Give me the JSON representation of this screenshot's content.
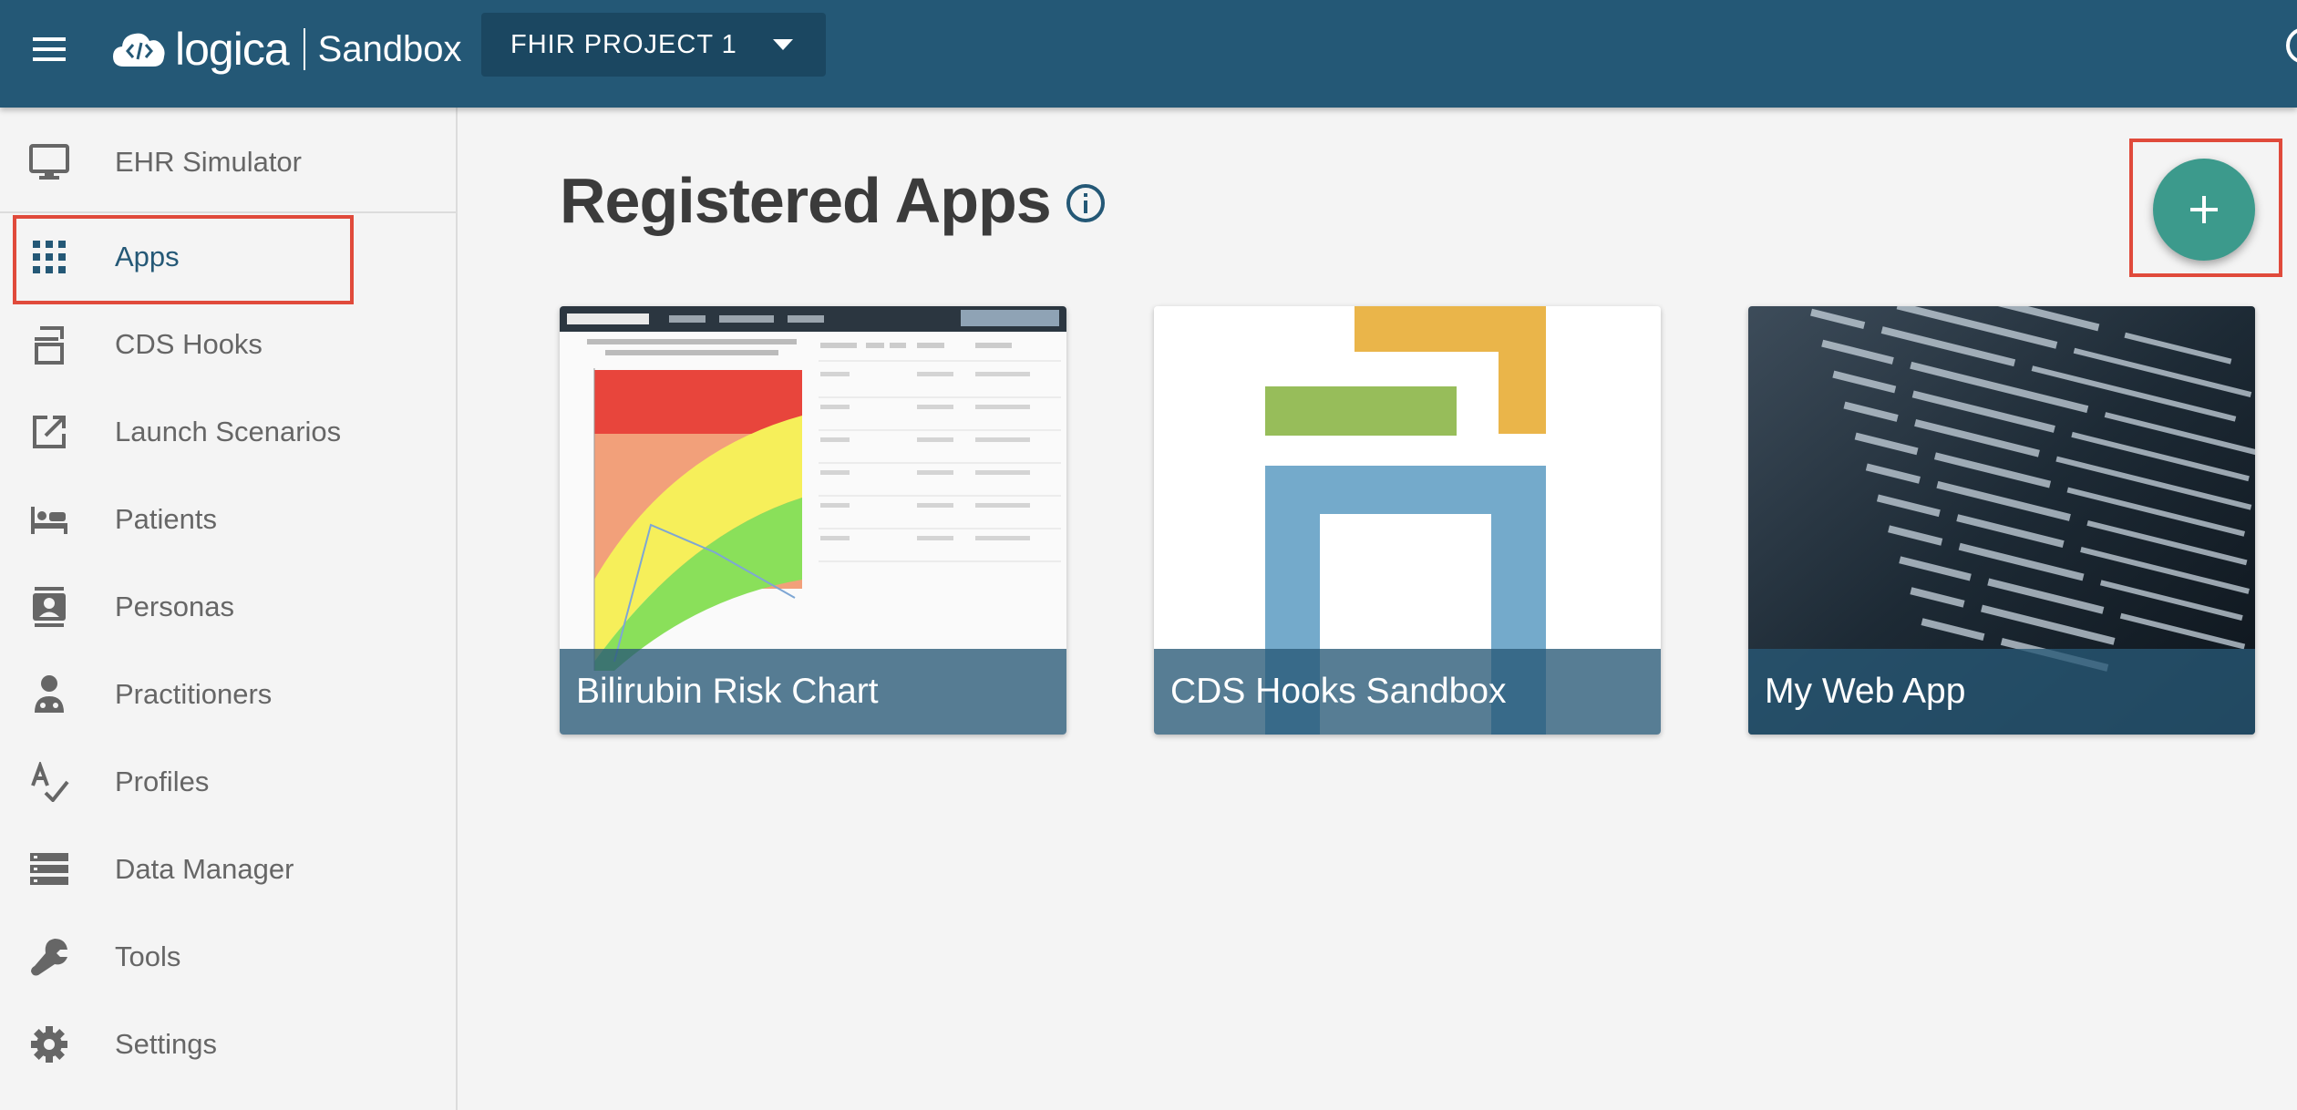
{
  "header": {
    "logo_text": "logica",
    "product": "Sandbox",
    "project_label": "FHIR PROJECT 1"
  },
  "sidebar": {
    "items": [
      {
        "label": "EHR Simulator",
        "icon": "monitor-icon"
      },
      {
        "label": "Apps",
        "icon": "apps-grid-icon",
        "active": true
      },
      {
        "label": "CDS Hooks",
        "icon": "cds-hooks-icon"
      },
      {
        "label": "Launch Scenarios",
        "icon": "launch-icon"
      },
      {
        "label": "Patients",
        "icon": "bed-icon"
      },
      {
        "label": "Personas",
        "icon": "contact-card-icon"
      },
      {
        "label": "Practitioners",
        "icon": "doctor-icon"
      },
      {
        "label": "Profiles",
        "icon": "spellcheck-icon"
      },
      {
        "label": "Data Manager",
        "icon": "storage-icon"
      },
      {
        "label": "Tools",
        "icon": "wrench-icon"
      },
      {
        "label": "Settings",
        "icon": "gear-icon"
      }
    ]
  },
  "main": {
    "title": "Registered Apps",
    "cards": [
      {
        "name": "Bilirubin Risk Chart"
      },
      {
        "name": "CDS Hooks Sandbox"
      },
      {
        "name": "My Web App"
      }
    ]
  },
  "colors": {
    "header": "#245876",
    "accent_fab": "#3c9a8c",
    "highlight": "#e04a3b",
    "active_text": "#245876"
  }
}
